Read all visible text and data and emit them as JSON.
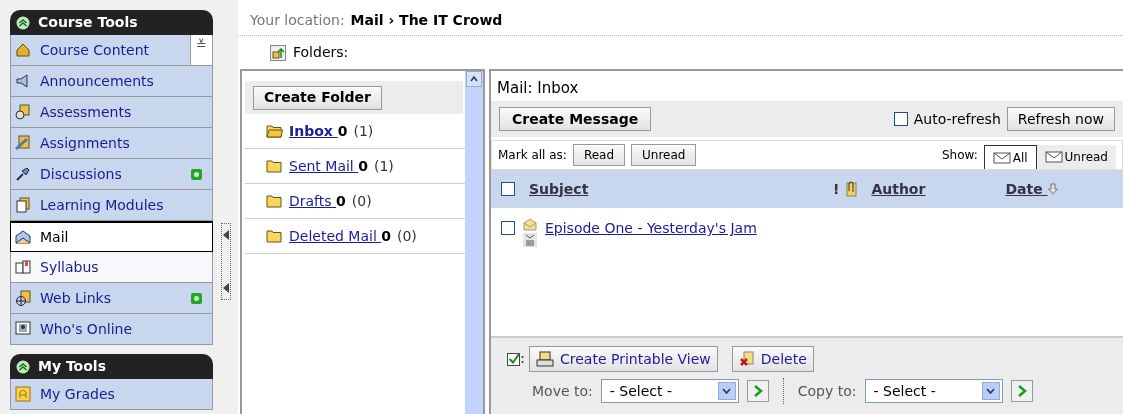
{
  "sidebar": {
    "sections": [
      {
        "title": "Course Tools",
        "items": [
          {
            "label": "Course Content",
            "selected": false,
            "highlighted": false,
            "new": false,
            "expander": "≚"
          },
          {
            "label": "Announcements",
            "selected": false,
            "highlighted": false,
            "new": false
          },
          {
            "label": "Assessments",
            "selected": false,
            "highlighted": false,
            "new": false
          },
          {
            "label": "Assignments",
            "selected": false,
            "highlighted": false,
            "new": false
          },
          {
            "label": "Discussions",
            "selected": false,
            "highlighted": false,
            "new": true
          },
          {
            "label": "Learning Modules",
            "selected": false,
            "highlighted": false,
            "new": false
          },
          {
            "label": "Mail",
            "selected": true,
            "highlighted": false,
            "new": false
          },
          {
            "label": "Syllabus",
            "selected": false,
            "highlighted": true,
            "new": false
          },
          {
            "label": "Web Links",
            "selected": false,
            "highlighted": false,
            "new": true
          },
          {
            "label": "Who's Online",
            "selected": false,
            "highlighted": false,
            "new": false
          }
        ]
      },
      {
        "title": "My Tools",
        "items": [
          {
            "label": "My Grades",
            "selected": false,
            "highlighted": false,
            "new": false
          }
        ]
      }
    ]
  },
  "breadcrumb": {
    "label": "Your location:",
    "path": "Mail › The IT Crowd"
  },
  "folders_label": "Folders:",
  "folders": {
    "create_button": "Create Folder",
    "items": [
      {
        "name": "Inbox ",
        "unread": "0",
        "total": "(1)",
        "selected": true
      },
      {
        "name": "Sent Mail ",
        "unread": "0",
        "total": "(1)",
        "selected": false
      },
      {
        "name": "Drafts ",
        "unread": "0",
        "total": "(0)",
        "selected": false
      },
      {
        "name": "Deleted Mail ",
        "unread": "0",
        "total": "(0)",
        "selected": false
      }
    ]
  },
  "mail": {
    "title": "Mail: Inbox",
    "create_button": "Create Message",
    "auto_refresh": {
      "label": "Auto-refresh",
      "checked": false
    },
    "refresh_button": "Refresh now",
    "mark_label": "Mark all as:",
    "mark_buttons": [
      "Read",
      "Unread"
    ],
    "show_label": "Show:",
    "show_tabs": [
      {
        "label": "All",
        "selected": true
      },
      {
        "label": "Unread",
        "selected": false
      }
    ],
    "columns": {
      "select_all_checked": false,
      "subject": "Subject",
      "priority": "!",
      "author": "Author",
      "date": "Date "
    },
    "messages": [
      {
        "subject": "Episode One - Yesterday's Jam",
        "checked": false
      }
    ],
    "actions": {
      "printable": "Create Printable View",
      "delete": "Delete",
      "move_label": "Move to:",
      "move_value": "- Select -",
      "copy_label": "Copy to:",
      "copy_value": "- Select -"
    }
  }
}
